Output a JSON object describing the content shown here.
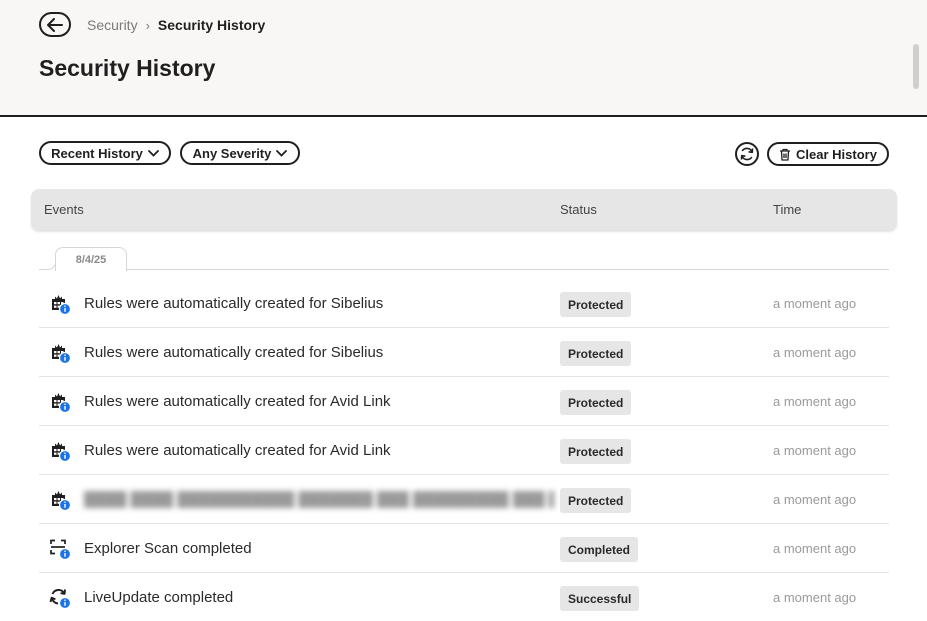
{
  "breadcrumb": {
    "parent": "Security",
    "separator": "›",
    "current": "Security History"
  },
  "page_title": "Security History",
  "filters": {
    "history": "Recent History",
    "severity": "Any Severity"
  },
  "toolbar": {
    "clear_label": "Clear History"
  },
  "table": {
    "headers": {
      "events": "Events",
      "status": "Status",
      "time": "Time"
    }
  },
  "date_group": "8/4/25",
  "rows": [
    {
      "icon": "firewall-info-icon",
      "event": "Rules were automatically created for Sibelius",
      "status": "Protected",
      "time": "a moment ago"
    },
    {
      "icon": "firewall-info-icon",
      "event": "Rules were automatically created for Sibelius",
      "status": "Protected",
      "time": "a moment ago"
    },
    {
      "icon": "firewall-info-icon",
      "event": "Rules were automatically created for Avid Link",
      "status": "Protected",
      "time": "a moment ago"
    },
    {
      "icon": "firewall-info-icon",
      "event": "Rules were automatically created for Avid Link",
      "status": "Protected",
      "time": "a moment ago"
    },
    {
      "icon": "firewall-info-icon",
      "event": "",
      "status": "Protected",
      "time": "a moment ago"
    },
    {
      "icon": "scan-info-icon",
      "event": "Explorer Scan completed",
      "status": "Completed",
      "time": "a moment ago"
    },
    {
      "icon": "liveupdate-info-icon",
      "event": "LiveUpdate completed",
      "status": "Successful",
      "time": "a moment ago"
    }
  ],
  "colors": {
    "accent": "#1f1f1f",
    "info_badge": "#1a73e8",
    "header_bg": "#f9f7f5",
    "badge_bg": "#e6e6e6"
  }
}
